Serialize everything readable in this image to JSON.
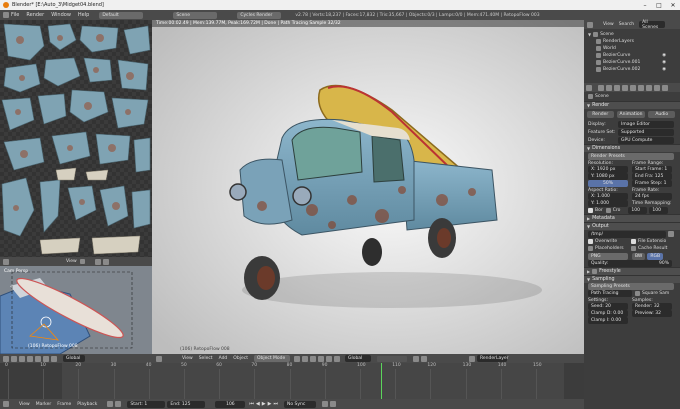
{
  "window": {
    "title": "Blender* [E:\\Auto_3\\Midget04.blend]",
    "controls": [
      "–",
      "□",
      "✕"
    ]
  },
  "menubar": {
    "items": [
      "File",
      "Render",
      "Window",
      "Help"
    ],
    "layout": "Default",
    "scene": "Scene",
    "engine": "Cycles Render",
    "stats": "v2.78 | Verts:18,237 | Faces:17,832 | Tris:35,667 | Objects:0/3 | Lamps:0/0 | Mem:471.40M | RetopoFlow 003"
  },
  "viewport": {
    "overlay": "Time:00:02.49 | Mem:139.77M, Peak:169.72M | Done | Path Tracing Sample 32/32",
    "object_label": "(106) RetopoFlow 008"
  },
  "uv_editor": {
    "header_buttons": [
      "View",
      "Image"
    ],
    "label": "View"
  },
  "camera_view": {
    "label": "Cam Persp",
    "object_label": "(106) RetopoFlow 008",
    "header": [
      "View",
      "Select",
      "Add"
    ]
  },
  "viewport_header": {
    "items": [
      "View",
      "Select",
      "Add",
      "Object"
    ],
    "mode": "Object Mode",
    "orientation": "Global",
    "layer": "RenderLayer"
  },
  "outliner": {
    "tabs": [
      "View",
      "Search",
      "All Scenes"
    ],
    "items": [
      {
        "label": "Scene",
        "indent": 0
      },
      {
        "label": "RenderLayers",
        "indent": 1
      },
      {
        "label": "World",
        "indent": 1
      },
      {
        "label": "BezierCurve",
        "indent": 1
      },
      {
        "label": "BezierCurve.001",
        "indent": 1
      },
      {
        "label": "BezierCurve.002",
        "indent": 1
      }
    ]
  },
  "properties": {
    "context": "Scene",
    "render": {
      "header": "Render",
      "buttons": [
        "Render",
        "Animation",
        "Audio"
      ],
      "display_label": "Display:",
      "display_value": "Image Editor",
      "feature_label": "Feature Set:",
      "feature_value": "Supported",
      "device_label": "Device:",
      "device_value": "GPU Compute"
    },
    "dimensions": {
      "header": "Dimensions",
      "presets": "Render Presets",
      "resolution_label": "Resolution:",
      "res_x": "1920 px",
      "res_y": "1080 px",
      "res_pct": "50%",
      "frame_range_label": "Frame Range:",
      "start": "Start Frame: 1",
      "end": "End Fra: 125",
      "step": "Frame Step: 1",
      "aspect_label": "Aspect Ratio:",
      "aspect_x": "1.000",
      "aspect_y": "1.000",
      "frame_rate_label": "Frame Rate:",
      "fps": "24 fps",
      "remap_label": "Time Remapping:",
      "remap_old": "100",
      "remap_new": "100",
      "border": "Bor",
      "crop": "Cro"
    },
    "metadata": {
      "header": "Metadata"
    },
    "output": {
      "header": "Output",
      "path": "/tmp/",
      "overwrite": "Overwrite",
      "file_extensions": "File Extensio",
      "placeholders": "Placeholders",
      "cache_result": "Cache Result",
      "format": "PNG",
      "bw": "BW",
      "rgb": "RGB",
      "quality_label": "Quality:",
      "quality": "90%"
    },
    "freestyle": {
      "header": "Freestyle"
    },
    "sampling": {
      "header": "Sampling",
      "presets": "Sampling Presets",
      "integrator": "Path Tracing",
      "square": "Square Sam",
      "settings_label": "Settings:",
      "samples_label": "Samples:",
      "seed": "Seed: 20",
      "render_samples": "Render: 32",
      "clamp_direct": "Clamp D: 0.00",
      "preview": "Preview: 32",
      "clamp_indirect": "Clamp I: 0.00"
    }
  },
  "timeline": {
    "items": [
      "View",
      "Marker",
      "Frame",
      "Playback"
    ],
    "start": "Start: 1",
    "end": "End: 125",
    "current": "106",
    "sync": "No Sync",
    "ticks": [
      "0",
      "10",
      "20",
      "30",
      "40",
      "50",
      "60",
      "70",
      "80",
      "90",
      "100",
      "110",
      "120",
      "130",
      "140",
      "150"
    ],
    "current_frame": 106
  },
  "colors": {
    "bg": "#3a3a3a",
    "header": "#4a4a4a",
    "accent": "#5a73a8",
    "viewport_bg": "#e6e6e6"
  }
}
